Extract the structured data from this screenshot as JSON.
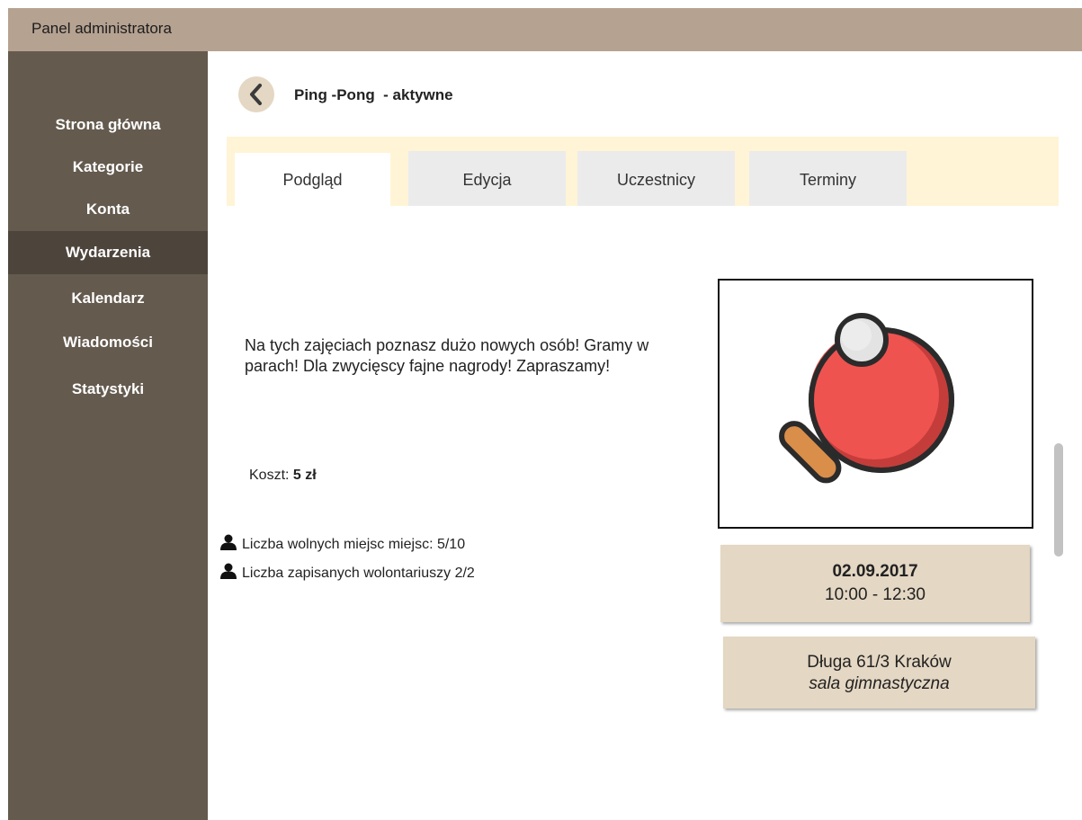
{
  "header": {
    "title": "Panel administratora"
  },
  "sidebar": {
    "items": [
      {
        "label": "Strona główna"
      },
      {
        "label": "Kategorie"
      },
      {
        "label": "Konta"
      },
      {
        "label": "Wydarzenia",
        "active": true
      },
      {
        "label": "Kalendarz"
      },
      {
        "label": "Wiadomości"
      },
      {
        "label": "Statystyki"
      }
    ]
  },
  "event": {
    "back_icon": "chevron-left-icon",
    "title": "Ping -Pong  - aktywne",
    "tabs": [
      {
        "label": "Podgląd",
        "active": true
      },
      {
        "label": "Edycja"
      },
      {
        "label": "Uczestnicy"
      },
      {
        "label": "Terminy"
      }
    ],
    "description": "Na tych zajęciach poznasz dużo nowych osób! Gramy w parach! Dla zwycięscy fajne nagrody! Zapraszamy!",
    "cost_label": "Koszt:",
    "cost_value": "5 zł",
    "stats": [
      {
        "icon": "user-icon",
        "text": "Liczba wolnych miejsc miejsc:  5/10"
      },
      {
        "icon": "user-icon",
        "text": "Liczba zapisanych wolontariuszy 2/2"
      }
    ],
    "image_icon": "ping-pong-paddle-icon",
    "date": "02.09.2017",
    "time": "10:00 - 12:30",
    "address": "Długa 61/3 Kraków",
    "room": "sala gimnastyczna"
  },
  "colors": {
    "topbar": "#b6a291",
    "sidebar": "#645a4e",
    "sidebar_active": "#4d443c",
    "tabbar": "#fff4d6",
    "info_box": "#e4d7c3",
    "paddle": "#ef5350"
  }
}
